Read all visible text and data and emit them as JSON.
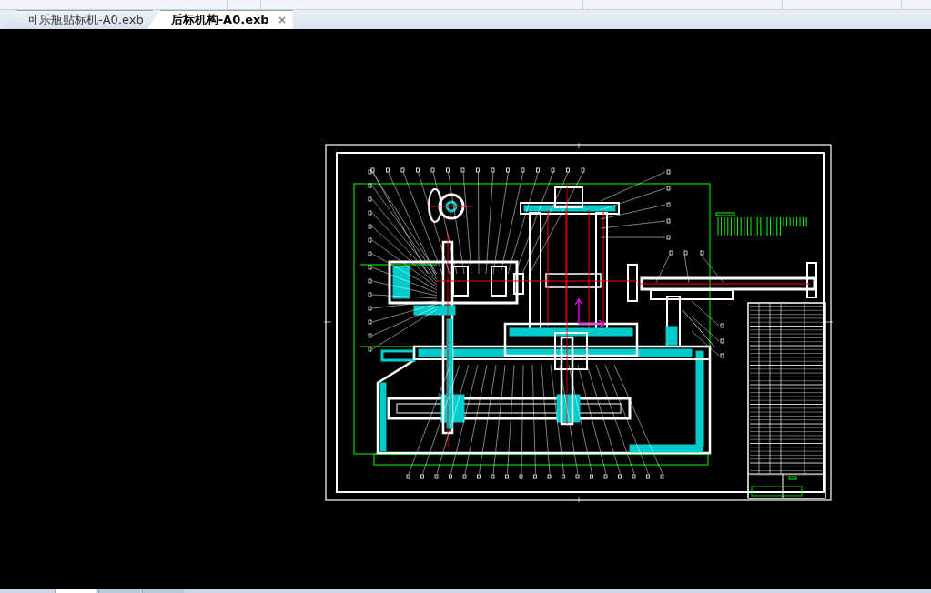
{
  "tabs": [
    {
      "label": "可乐瓶贴标机-A0.exb",
      "selected": false,
      "closable": false
    },
    {
      "label": "后标机构-A0.exb",
      "selected": true,
      "closable": true
    }
  ],
  "layout_tabs": [
    {
      "selected": true
    },
    {
      "selected": false
    },
    {
      "selected": false
    }
  ]
}
